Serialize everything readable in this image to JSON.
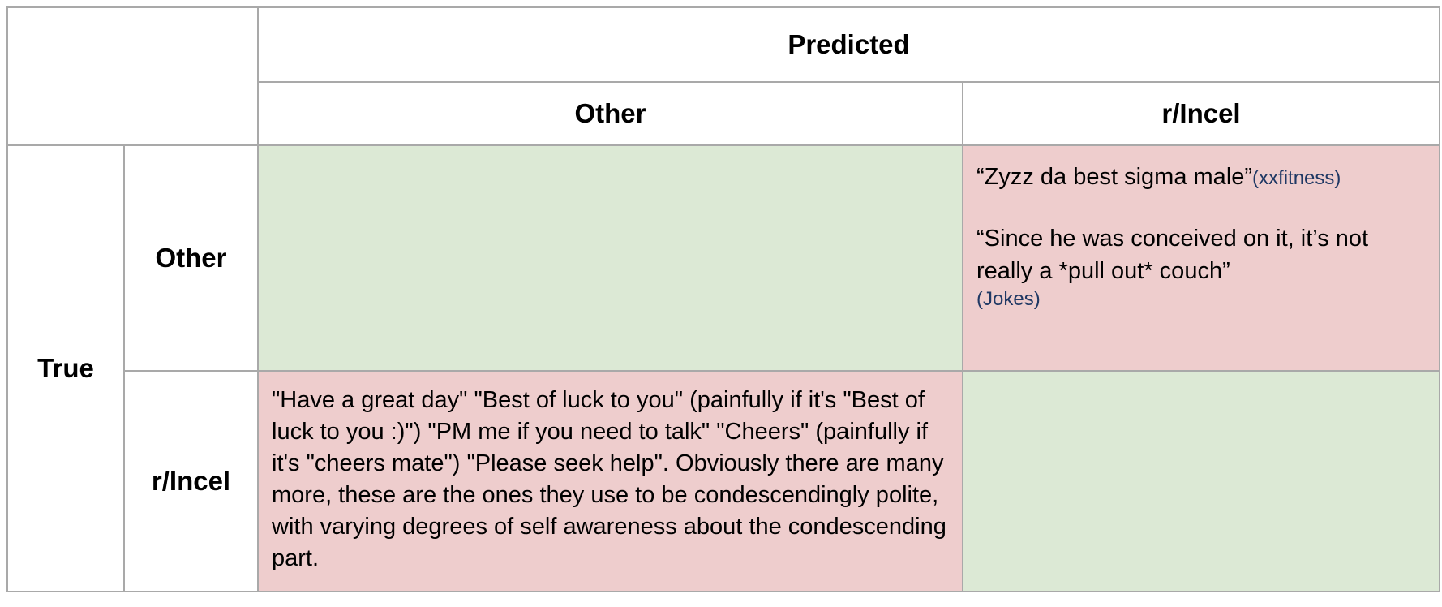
{
  "header": {
    "predicted_label": "Predicted",
    "true_label": "True",
    "col_other": "Other",
    "col_incel": "r/Incel",
    "row_other": "Other",
    "row_incel": "r/Incel"
  },
  "cells": {
    "fp_quote1_text": "“Zyzz da best sigma male”",
    "fp_quote1_source": "(xxfitness)",
    "fp_quote2_text": "“Since he was conceived on it, it’s not really a *pull out* couch”",
    "fp_quote2_source": "(Jokes)",
    "fn_text": "\"Have a great day\" \"Best of luck to you\" (painfully if it's \"Best of luck to you :)\") \"PM me if you need to talk\" \"Cheers\" (painfully if it's \"cheers mate\") \"Please seek help\". Obviously there are many more, these are the ones they use to be condescendingly polite, with varying degrees of self awareness about the condescending part."
  },
  "colors": {
    "correct_cell": "#dce9d5",
    "error_cell": "#eecdcd",
    "source_text": "#1f3864",
    "border": "#a9a9a9"
  }
}
